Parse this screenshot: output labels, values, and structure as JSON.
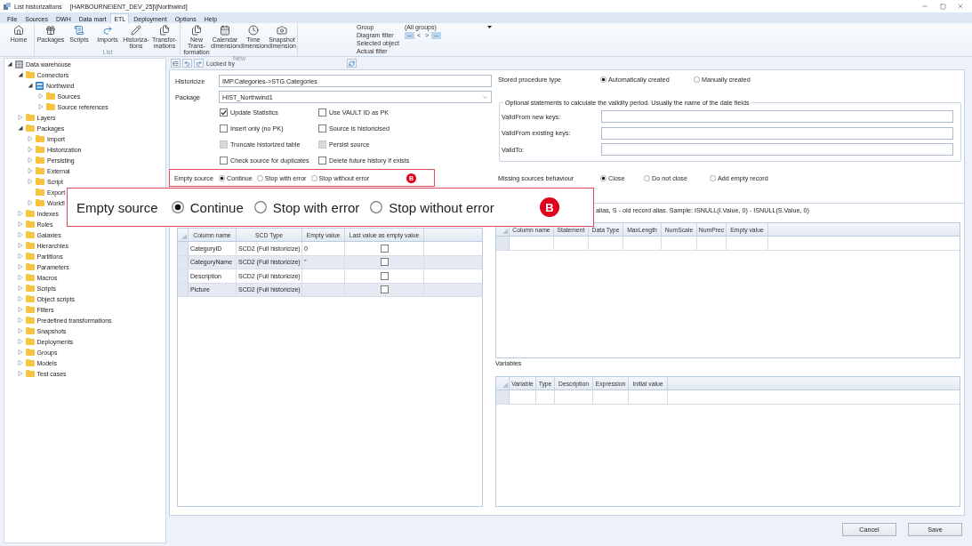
{
  "window": {
    "title": "List historizations",
    "subtitle": "[HARBOURNE\\ENT_DEV_25]\\[Northwind]"
  },
  "menu_tabs": [
    {
      "label": "File",
      "selected": false
    },
    {
      "label": "Sources",
      "selected": false
    },
    {
      "label": "DWH",
      "selected": false
    },
    {
      "label": "Data mart",
      "selected": false
    },
    {
      "label": "ETL",
      "selected": true
    },
    {
      "label": "Deployment",
      "selected": false
    },
    {
      "label": "Options",
      "selected": false
    },
    {
      "label": "Help",
      "selected": false
    }
  ],
  "ribbon": {
    "groups": [
      {
        "buttons": [
          {
            "label": "Home"
          }
        ]
      },
      {
        "label": "List",
        "buttons": [
          {
            "label": "Packages"
          },
          {
            "label": "Scripts"
          },
          {
            "label": "Imports"
          },
          {
            "label": "Historiza-\ntions"
          },
          {
            "label": "Transfor-\nmations"
          }
        ]
      },
      {
        "label": "New",
        "buttons": [
          {
            "label": "New Trans-\nformation"
          },
          {
            "label": "Calendar\ndimension"
          },
          {
            "label": "Time\ndimension"
          },
          {
            "label": "Snapshot\ndimension"
          }
        ]
      }
    ],
    "filters": [
      {
        "kind": "dropdown",
        "label": "Group",
        "value": "(All groups)"
      },
      {
        "kind": "buttons",
        "label": "Diagram filter",
        "buttons": [
          {
            "label": "--",
            "kind": "field"
          },
          {
            "label": "<",
            "kind": "arrow"
          },
          {
            "label": ">",
            "kind": "arrow"
          },
          {
            "label": "--",
            "kind": "field"
          }
        ]
      },
      {
        "kind": "text",
        "label": "Selected object"
      },
      {
        "kind": "text",
        "label": "Actual filter"
      }
    ]
  },
  "tree": [
    {
      "label": "Data warehouse",
      "kind": "warehouse",
      "expanded": true,
      "children": [
        {
          "label": "Connectors",
          "kind": "folder",
          "expanded": true,
          "children": [
            {
              "label": "Northwind",
              "kind": "database",
              "expanded": true,
              "children": [
                {
                  "label": "Sources",
                  "kind": "folder",
                  "expanded": false
                },
                {
                  "label": "Source references",
                  "kind": "folder",
                  "expanded": false
                }
              ]
            }
          ]
        },
        {
          "label": "Layers",
          "kind": "folder",
          "expanded": false
        },
        {
          "label": "Packages",
          "kind": "folder",
          "expanded": true,
          "children": [
            {
              "label": "Import",
              "kind": "folder",
              "expanded": false
            },
            {
              "label": "Historization",
              "kind": "folder",
              "expanded": false
            },
            {
              "label": "Persisting",
              "kind": "folder",
              "expanded": false
            },
            {
              "label": "External",
              "kind": "folder",
              "expanded": false
            },
            {
              "label": "Script",
              "kind": "folder",
              "expanded": false
            },
            {
              "label": "Export",
              "kind": "folder"
            },
            {
              "label": "Workfl",
              "kind": "folder",
              "expanded": false
            }
          ]
        },
        {
          "label": "Indexes",
          "kind": "folder",
          "expanded": false
        },
        {
          "label": "Roles",
          "kind": "folder",
          "expanded": false
        },
        {
          "label": "Galaxies",
          "kind": "folder",
          "expanded": false
        },
        {
          "label": "Hierarchies",
          "kind": "folder",
          "expanded": false
        },
        {
          "label": "Partitions",
          "kind": "folder",
          "expanded": false
        },
        {
          "label": "Parameters",
          "kind": "folder",
          "expanded": false
        },
        {
          "label": "Macros",
          "kind": "folder",
          "expanded": false
        },
        {
          "label": "Scripts",
          "kind": "folder",
          "expanded": false
        },
        {
          "label": "Object scripts",
          "kind": "folder",
          "expanded": false
        },
        {
          "label": "Filters",
          "kind": "folder",
          "expanded": false
        },
        {
          "label": "Predefined transformations",
          "kind": "folder",
          "expanded": false
        },
        {
          "label": "Snapshots",
          "kind": "folder",
          "expanded": false
        },
        {
          "label": "Deployments",
          "kind": "folder",
          "expanded": false
        },
        {
          "label": "Groups",
          "kind": "folder",
          "expanded": false
        },
        {
          "label": "Models",
          "kind": "folder",
          "expanded": false
        },
        {
          "label": "Test cases",
          "kind": "folder",
          "expanded": false
        }
      ]
    }
  ],
  "toolbar": {
    "locked_by_label": "Locked by"
  },
  "form": {
    "historicize": {
      "label": "Historicize",
      "value": "IMP.Categories->STG.Categories"
    },
    "package": {
      "label": "Package",
      "value": "HIST_Northwind1"
    },
    "options": [
      {
        "label": "Update Statistics",
        "checked": true,
        "disabled": false
      },
      {
        "label": "Use VAULT ID as PK",
        "checked": false,
        "disabled": false
      },
      {
        "label": "Insert only (no PK)",
        "checked": false,
        "disabled": false
      },
      {
        "label": "Source is historicised",
        "checked": false,
        "disabled": false
      },
      {
        "label": "Truncate historized table",
        "checked": false,
        "disabled": true
      },
      {
        "label": "Persist source",
        "checked": false,
        "disabled": true
      },
      {
        "label": "Check source for duplicates",
        "checked": false,
        "disabled": false
      },
      {
        "label": "Delete future history if exists",
        "checked": false,
        "disabled": false
      }
    ],
    "empty_source": {
      "label": "Empty source",
      "highlighted": true,
      "badge": "B",
      "options": [
        {
          "label": "Continue",
          "selected": true
        },
        {
          "label": "Stop with error",
          "selected": false
        },
        {
          "label": "Stop without error",
          "selected": false
        }
      ]
    },
    "columns_grid": {
      "columns": [
        "Column name",
        "SCD Type",
        "Empty value",
        "Last value as empty value"
      ],
      "rows": [
        {
          "column_name": "CategoryID",
          "scd_type": "SCD2 (Full historicize)",
          "empty_value": "0",
          "last_value_as_empty": false
        },
        {
          "column_name": "CategoryName",
          "scd_type": "SCD2 (Full historicize)",
          "empty_value": "''",
          "last_value_as_empty": false
        },
        {
          "column_name": "Description",
          "scd_type": "SCD2 (Full historicize)",
          "last_value_as_empty": false
        },
        {
          "column_name": "Picture",
          "scd_type": "SCD2 (Full historicize)",
          "last_value_as_empty": false
        }
      ]
    },
    "stored_procedure_type": {
      "label": "Stored procedure type",
      "options": [
        {
          "label": "Automatically created",
          "selected": true
        },
        {
          "label": "Manually created",
          "selected": false
        }
      ]
    },
    "validity_period": {
      "title": "Optional statements to calculate the validity period. Usually the name of the date fields",
      "fields": [
        {
          "label": "ValidFrom new keys:"
        },
        {
          "label": "ValidFrom existing keys:"
        },
        {
          "label": "ValidTo:"
        }
      ]
    },
    "missing_sources_behaviour": {
      "label": "Missing sources behaviour",
      "options": [
        {
          "label": "Close",
          "selected": true
        },
        {
          "label": "Do not close",
          "selected": false
        },
        {
          "label": "Add empty record",
          "selected": false
        }
      ]
    },
    "calculated_note": "alias, S - old record alias. Sample: ISNULL(I.Value, 0) - ISNULL(S.Value, 0)",
    "calculated_grid": {
      "columns": [
        "Column name",
        "Statement",
        "Data Type",
        "MaxLength",
        "NumScale",
        "NumPrec",
        "Empty value"
      ]
    },
    "variables": {
      "label": "Variables",
      "columns": [
        "Variable",
        "Type",
        "Description",
        "Expression",
        "Initial value"
      ]
    }
  },
  "buttons": [
    {
      "label": "Cancel"
    },
    {
      "label": "Save"
    }
  ],
  "callout": {
    "label": "Empty source",
    "badge": "B",
    "options": [
      {
        "label": "Continue",
        "selected": true
      },
      {
        "label": "Stop with error",
        "selected": false
      },
      {
        "label": "Stop without error",
        "selected": false
      }
    ]
  }
}
